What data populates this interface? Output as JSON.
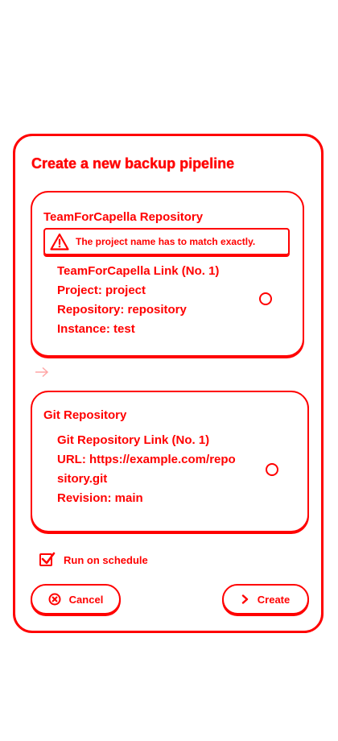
{
  "dialog": {
    "title": "Create a new backup pipeline"
  },
  "source": {
    "title": "TeamForCapella Repository",
    "warning": "The project name has to match exactly.",
    "link_label": "TeamForCapella Link (No. 1)",
    "project": "Project: project",
    "repository": "Repository: repository",
    "instance": "Instance: test"
  },
  "target": {
    "title": "Git Repository",
    "link_label": "Git Repository Link (No. 1)",
    "url": "URL: https://example.com/repository.git",
    "revision": "Revision: main"
  },
  "schedule": {
    "label": "Run on schedule",
    "checked": true
  },
  "actions": {
    "cancel_label": "Cancel",
    "create_label": "Create"
  },
  "colors": {
    "accent": "#ff0000",
    "background": "#ffffff"
  },
  "icons": {
    "warning": "warning-triangle-icon",
    "arrow": "arrow-right-icon",
    "cancel": "cancel-circle-icon",
    "create": "chevron-right-icon",
    "checkbox": "check-icon"
  }
}
